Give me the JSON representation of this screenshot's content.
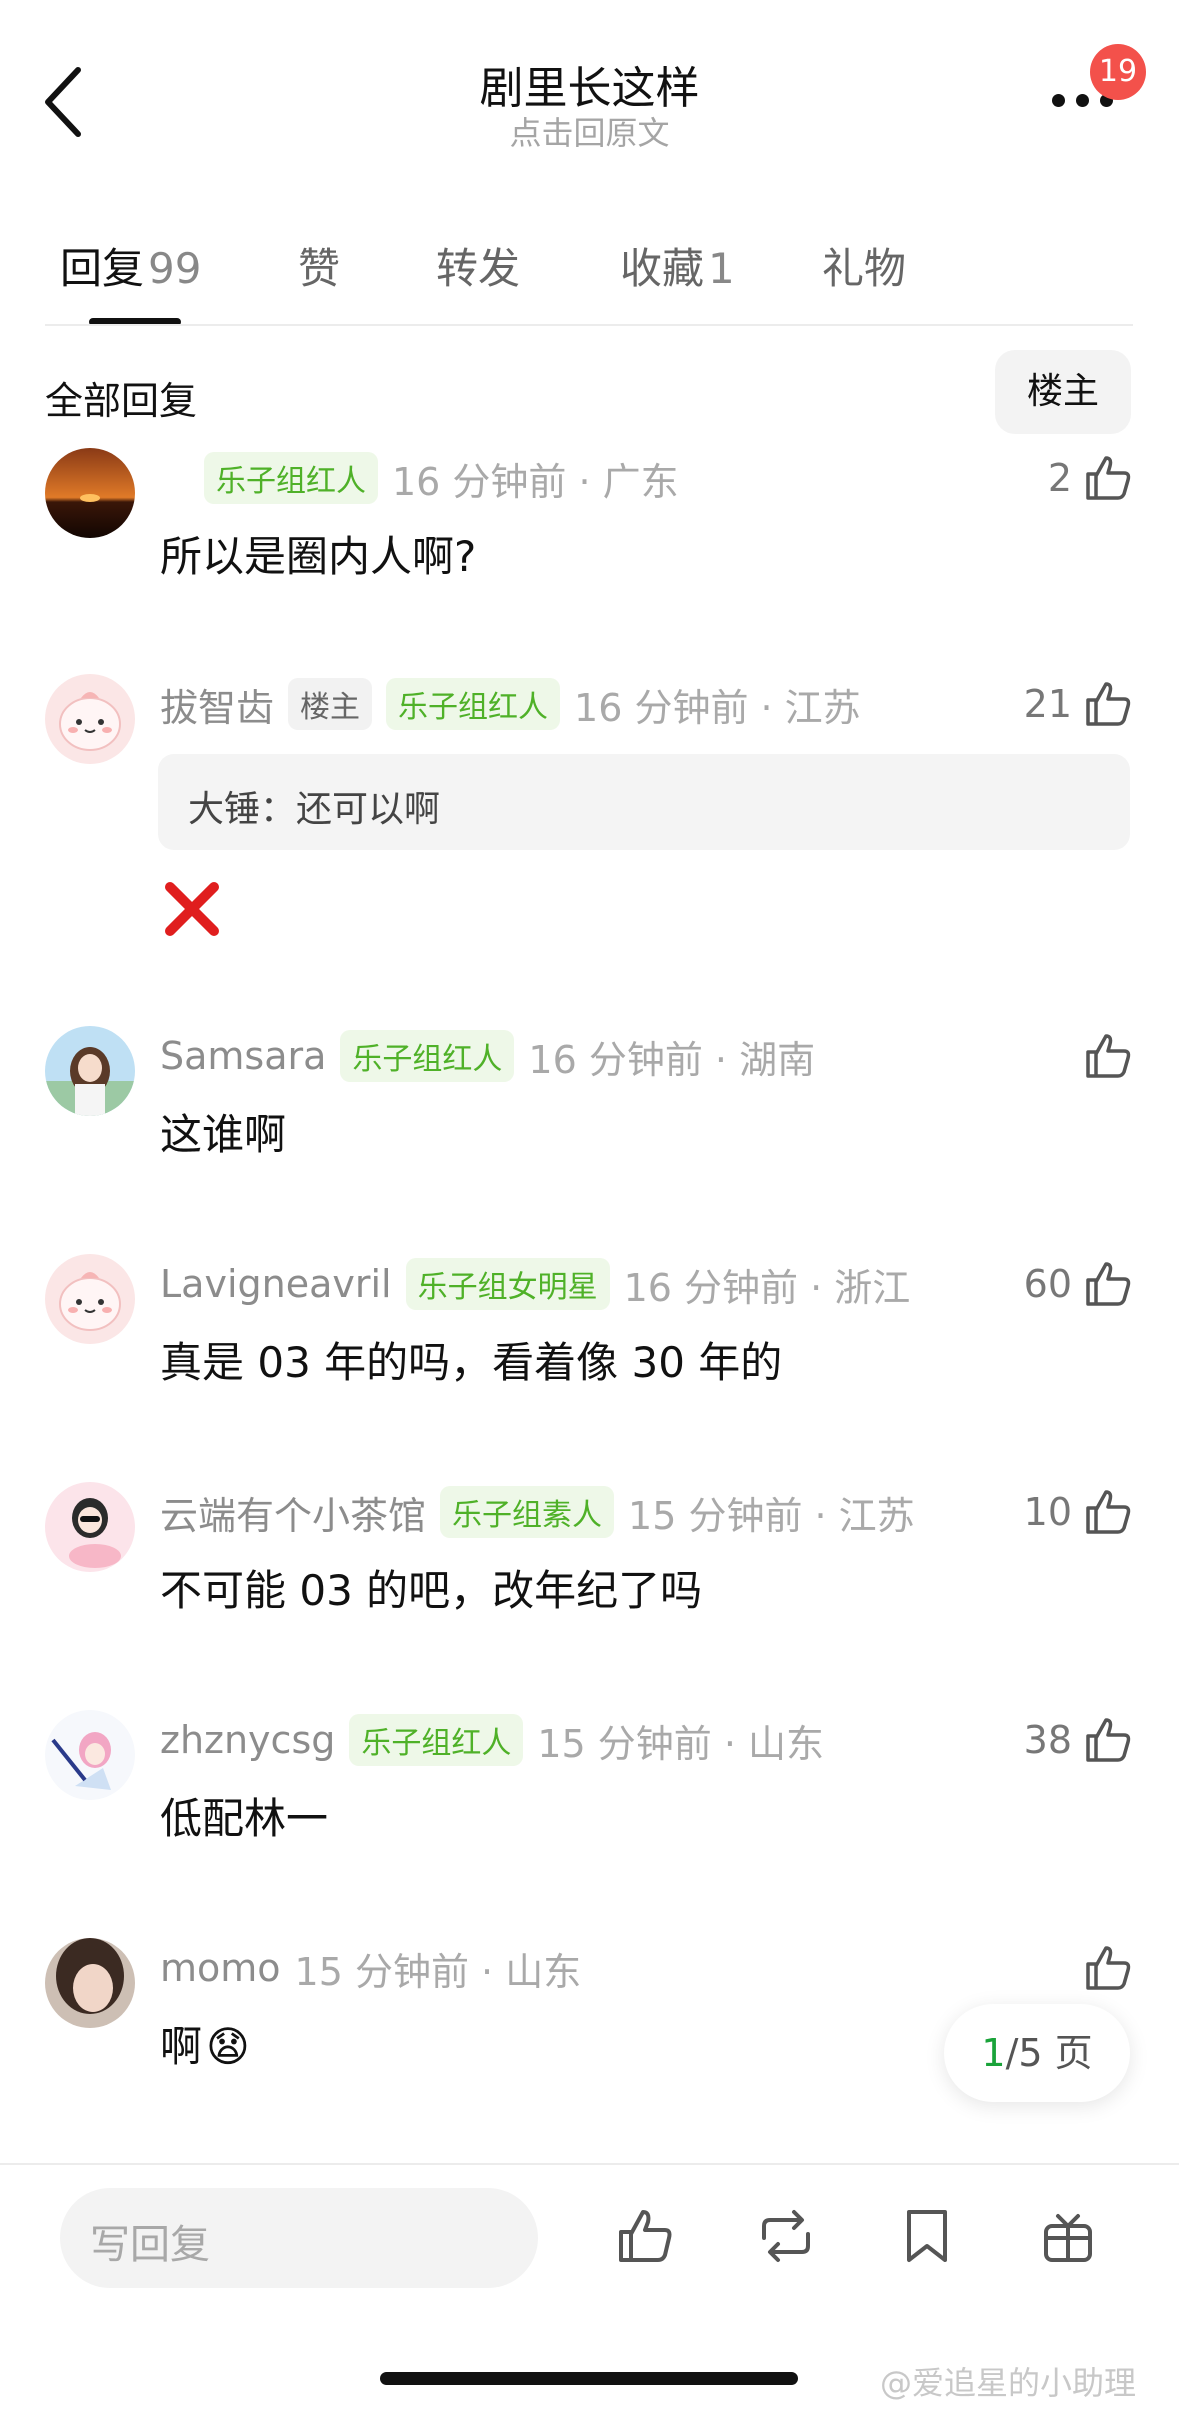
{
  "header": {
    "title": "剧里长这样",
    "subtitle": "点击回原文",
    "badge": "19"
  },
  "tabs": [
    {
      "label": "回复",
      "count": "99",
      "active": true
    },
    {
      "label": "赞",
      "count": ""
    },
    {
      "label": "转发",
      "count": ""
    },
    {
      "label": "收藏",
      "count": "1"
    },
    {
      "label": "礼物",
      "count": ""
    }
  ],
  "section": {
    "title": "全部回复",
    "op_button": "楼主"
  },
  "comments": [
    {
      "user": "",
      "tags": [
        "乐子组红人"
      ],
      "time": "16 分钟前 · 广东",
      "likes": "2",
      "text": "所以是圈内人啊?"
    },
    {
      "user": "拔智齿",
      "op_tag": "楼主",
      "tags": [
        "乐子组红人"
      ],
      "time": "16 分钟前 · 江苏",
      "likes": "21",
      "quote": "大锤：还可以啊",
      "text": ""
    },
    {
      "user": "Samsara",
      "tags": [
        "乐子组红人"
      ],
      "time": "16 分钟前 · 湖南",
      "likes": "",
      "text": "这谁啊"
    },
    {
      "user": "Lavigneavril",
      "tags": [
        "乐子组女明星"
      ],
      "time": "16 分钟前 · 浙江",
      "likes": "60",
      "text": "真是 03 年的吗，看着像 30 年的"
    },
    {
      "user": "云端有个小茶馆",
      "tags": [
        "乐子组素人"
      ],
      "time": "15 分钟前 · 江苏",
      "likes": "10",
      "text": "不可能 03 的吧，改年纪了吗"
    },
    {
      "user": "zhznycsg",
      "tags": [
        "乐子组红人"
      ],
      "time": "15 分钟前 · 山东",
      "likes": "38",
      "text": "低配林一"
    },
    {
      "user": "momo",
      "tags": [],
      "time": "15 分钟前 · 山东",
      "likes": "",
      "text": "啊",
      "emoji": "😧"
    }
  ],
  "pager": {
    "current": "1",
    "total": "/5 页"
  },
  "bottom": {
    "reply_placeholder": "写回复"
  },
  "watermark": "@爱追星的小助理",
  "colors": {
    "tag_green": "#4fb128",
    "badge_red": "#f3514b",
    "pager_green": "#1aa33a"
  }
}
